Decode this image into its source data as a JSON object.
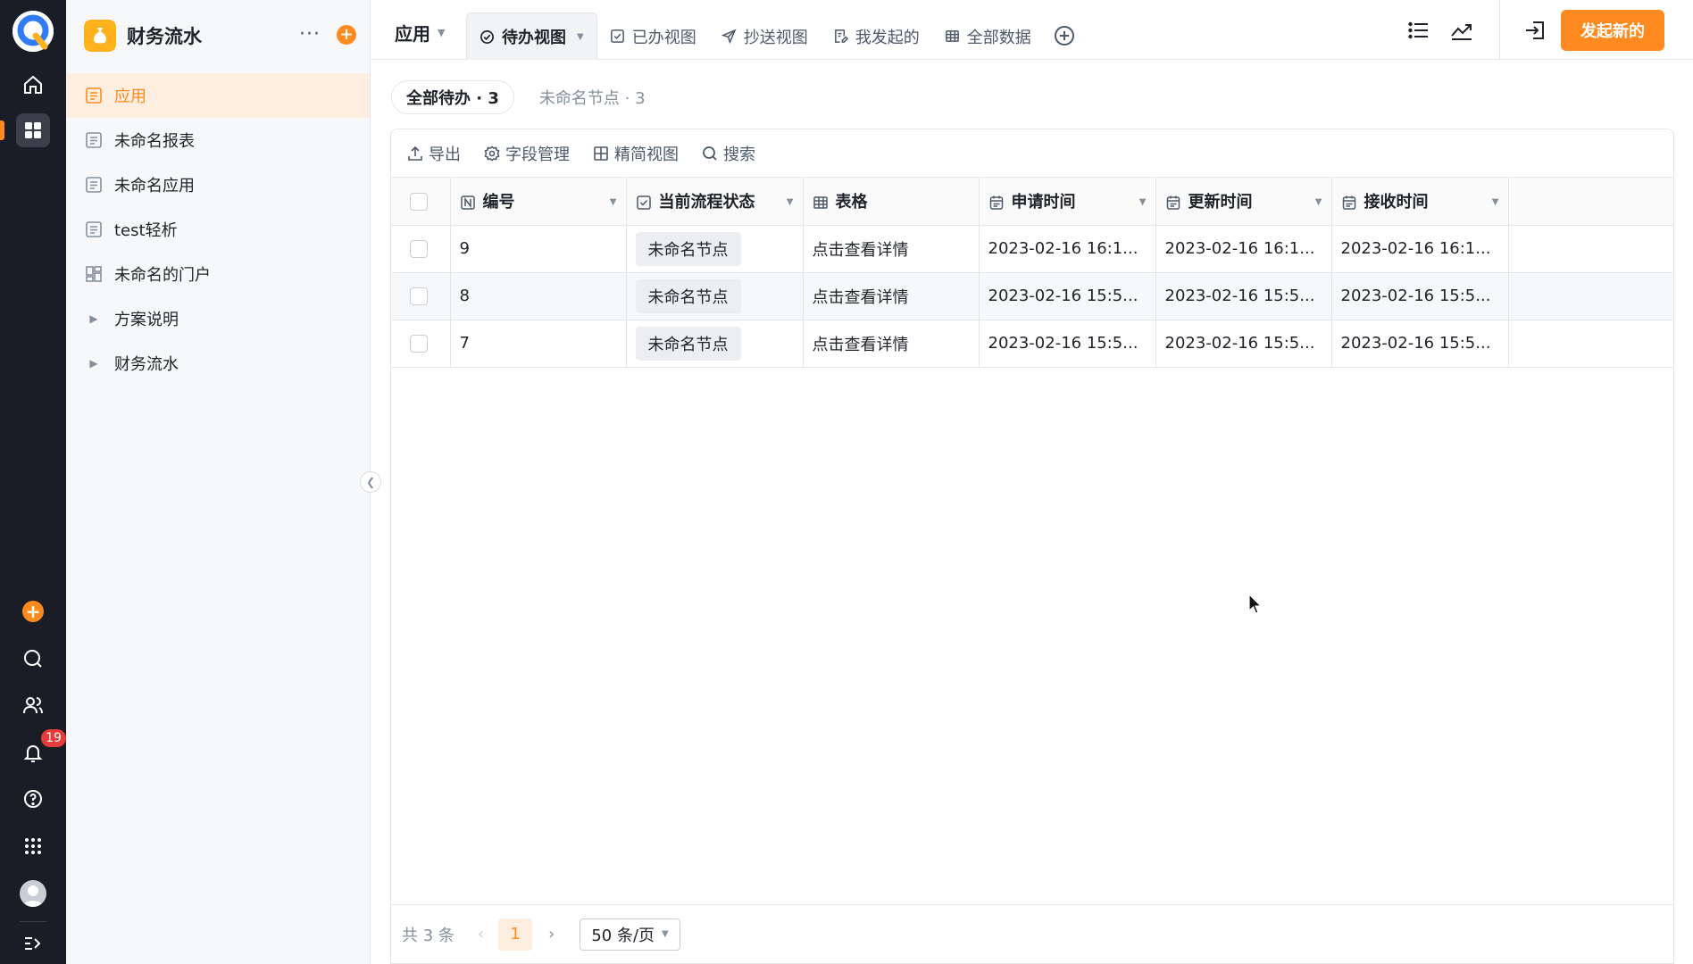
{
  "rail": {
    "notification_count": "19"
  },
  "app": {
    "name": "财务流水",
    "more": "···",
    "add": "+"
  },
  "nav": [
    {
      "label": "应用",
      "icon": "form-icon",
      "active": true
    },
    {
      "label": "未命名报表",
      "icon": "form-icon"
    },
    {
      "label": "未命名应用",
      "icon": "form-icon"
    },
    {
      "label": "test轻析",
      "icon": "form-icon"
    },
    {
      "label": "未命名的门户",
      "icon": "portal-icon"
    },
    {
      "label": "方案说明",
      "icon": "caret-right-icon"
    },
    {
      "label": "财务流水",
      "icon": "caret-right-icon"
    }
  ],
  "topbar": {
    "app_label": "应用",
    "tabs": [
      {
        "label": "待办视图",
        "icon": "check-circle-icon",
        "active": true
      },
      {
        "label": "已办视图",
        "icon": "check-square-icon"
      },
      {
        "label": "抄送视图",
        "icon": "send-icon"
      },
      {
        "label": "我发起的",
        "icon": "edit-doc-icon"
      },
      {
        "label": "全部数据",
        "icon": "table-icon"
      }
    ],
    "start_button": "发起新的"
  },
  "subtabs": [
    {
      "label": "全部待办 · 3",
      "active": true
    },
    {
      "label": "未命名节点 · 3"
    }
  ],
  "toolbar": {
    "export": "导出",
    "fields": "字段管理",
    "compact": "精简视图",
    "search": "搜索"
  },
  "table": {
    "columns": [
      {
        "label": "编号",
        "icon": "number-icon"
      },
      {
        "label": "当前流程状态",
        "icon": "check-square-icon"
      },
      {
        "label": "表格",
        "icon": "table-icon"
      },
      {
        "label": "申请时间",
        "icon": "calendar-icon"
      },
      {
        "label": "更新时间",
        "icon": "calendar-icon"
      },
      {
        "label": "接收时间",
        "icon": "calendar-icon"
      }
    ],
    "rows": [
      {
        "id": "9",
        "status": "未命名节点",
        "table": "点击查看详情",
        "apply": "2023-02-16 16:1...",
        "update": "2023-02-16 16:1...",
        "receive": "2023-02-16 16:1..."
      },
      {
        "id": "8",
        "status": "未命名节点",
        "table": "点击查看详情",
        "apply": "2023-02-16 15:5...",
        "update": "2023-02-16 15:5...",
        "receive": "2023-02-16 15:5..."
      },
      {
        "id": "7",
        "status": "未命名节点",
        "table": "点击查看详情",
        "apply": "2023-02-16 15:5...",
        "update": "2023-02-16 15:5...",
        "receive": "2023-02-16 15:5..."
      }
    ]
  },
  "pager": {
    "total": "共 3 条",
    "current_page": "1",
    "page_size": "50 条/页"
  },
  "colors": {
    "accent": "#ff8a1f",
    "rail_bg": "#1a1d26",
    "badge": "#e63c3c"
  }
}
